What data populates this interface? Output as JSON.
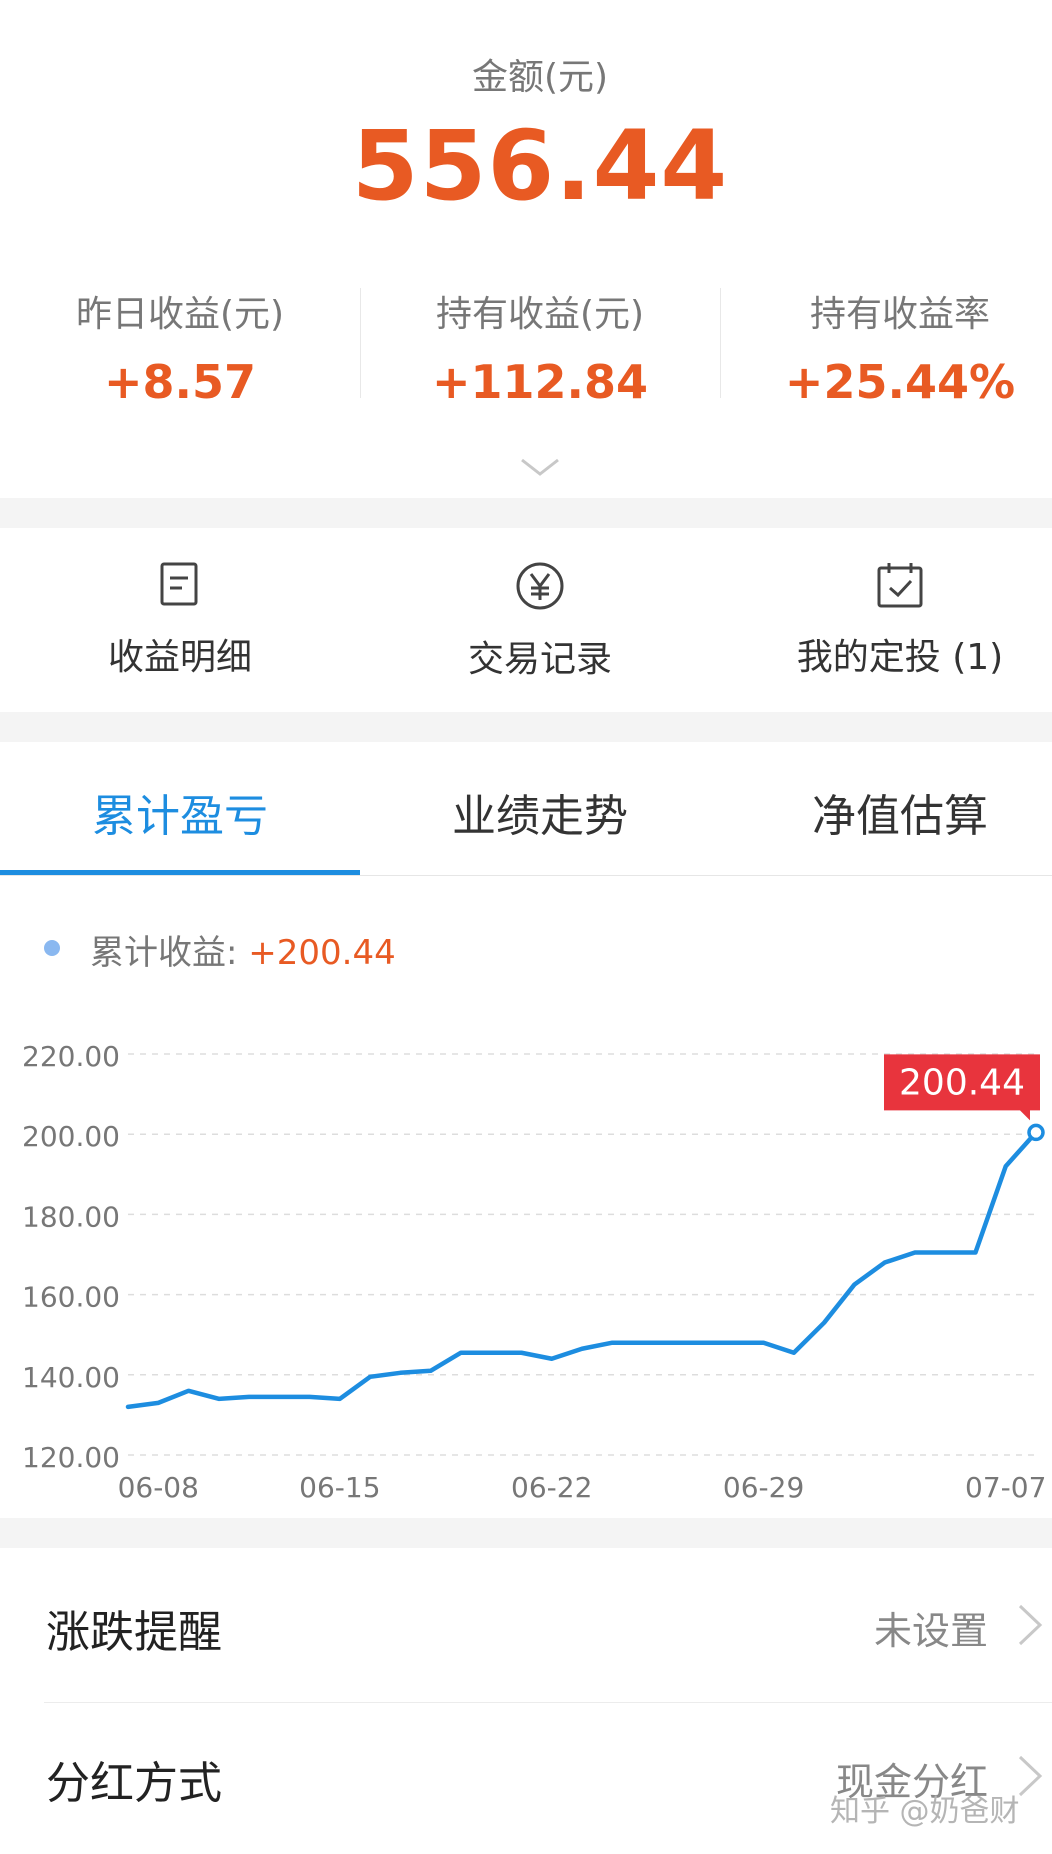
{
  "summary": {
    "amount_label": "金额(元)",
    "amount_value": "556.44",
    "stats": [
      {
        "label": "昨日收益(元)",
        "value": "+8.57"
      },
      {
        "label": "持有收益(元)",
        "value": "+112.84"
      },
      {
        "label": "持有收益率",
        "value": "+25.44%"
      }
    ],
    "expand_icon": "chevron-down-icon"
  },
  "quick_actions": [
    {
      "label": "收益明细",
      "icon": "document-icon"
    },
    {
      "label": "交易记录",
      "icon": "yen-circle-icon"
    },
    {
      "label": "我的定投 (1)",
      "icon": "calendar-check-icon"
    }
  ],
  "tabs": [
    {
      "label": "累计盈亏",
      "active": true
    },
    {
      "label": "业绩走势",
      "active": false
    },
    {
      "label": "净值估算",
      "active": false
    }
  ],
  "legend": {
    "label": "累计收益: ",
    "value": "+200.44"
  },
  "chart_data": {
    "type": "line",
    "x_tick_labels": [
      "06-08",
      "06-15",
      "06-22",
      "06-29",
      "07-07"
    ],
    "y_tick_labels": [
      "220.00",
      "200.00",
      "180.00",
      "160.00",
      "140.00",
      "120.00"
    ],
    "ylim": [
      120,
      220
    ],
    "grid": true,
    "series": [
      {
        "values": [
          132,
          133,
          136,
          134,
          134.5,
          134.5,
          134.5,
          134,
          139.5,
          140.5,
          141,
          145.5,
          145.5,
          145.5,
          144,
          146.5,
          148,
          148,
          148,
          148,
          148,
          148,
          145.5,
          153,
          162.5,
          168,
          170.5,
          170.5,
          170.5,
          192,
          200.44
        ]
      }
    ],
    "last_value_label": "200.44",
    "colors": {
      "line": "#1d8de0",
      "badge": "#e8343d",
      "grid": "#dddddd",
      "tick": "#777777"
    }
  },
  "settings": [
    {
      "title": "涨跌提醒",
      "value": "未设置"
    },
    {
      "title": "分红方式",
      "value": "现金分红"
    }
  ],
  "watermark": "知乎 @奶爸财"
}
